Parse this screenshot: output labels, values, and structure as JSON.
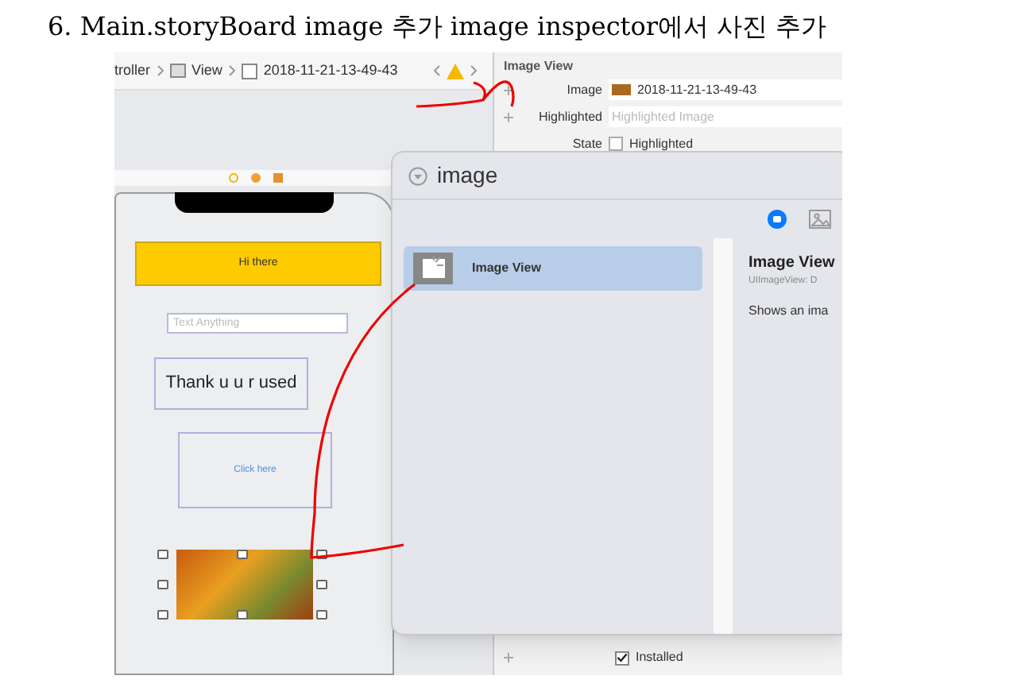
{
  "heading": "6. Main.storyBoard image 추가 image inspector에서 사진 추가",
  "breadcrumb": [
    "troller",
    "View",
    "2018-11-21-13-49-43"
  ],
  "scene": {
    "button": "Hi there",
    "text_field": {
      "placeholder": "Text Anything"
    },
    "label": "Thank u u r used",
    "link_button": "Click here"
  },
  "inspector": {
    "title": "Image View",
    "rows": [
      {
        "kind": "image",
        "label": "Image",
        "value": "2018-11-21-13-49-43"
      },
      {
        "kind": "field",
        "label": "Highlighted",
        "placeholder": "Highlighted Image"
      },
      {
        "kind": "checkbox",
        "label": "State",
        "text": "Highlighted",
        "checked": false
      }
    ],
    "installed": {
      "text": "Installed",
      "checked": true
    }
  },
  "library": {
    "search": "image",
    "tabs": [
      {
        "kind": "objects",
        "selected": true
      },
      {
        "kind": "media",
        "selected": false
      }
    ],
    "items": [
      {
        "label": "Image View",
        "selected": true
      }
    ],
    "detail": {
      "title": "Image View",
      "subtitle": "UIImageView: D",
      "description": "Shows an ima"
    }
  }
}
